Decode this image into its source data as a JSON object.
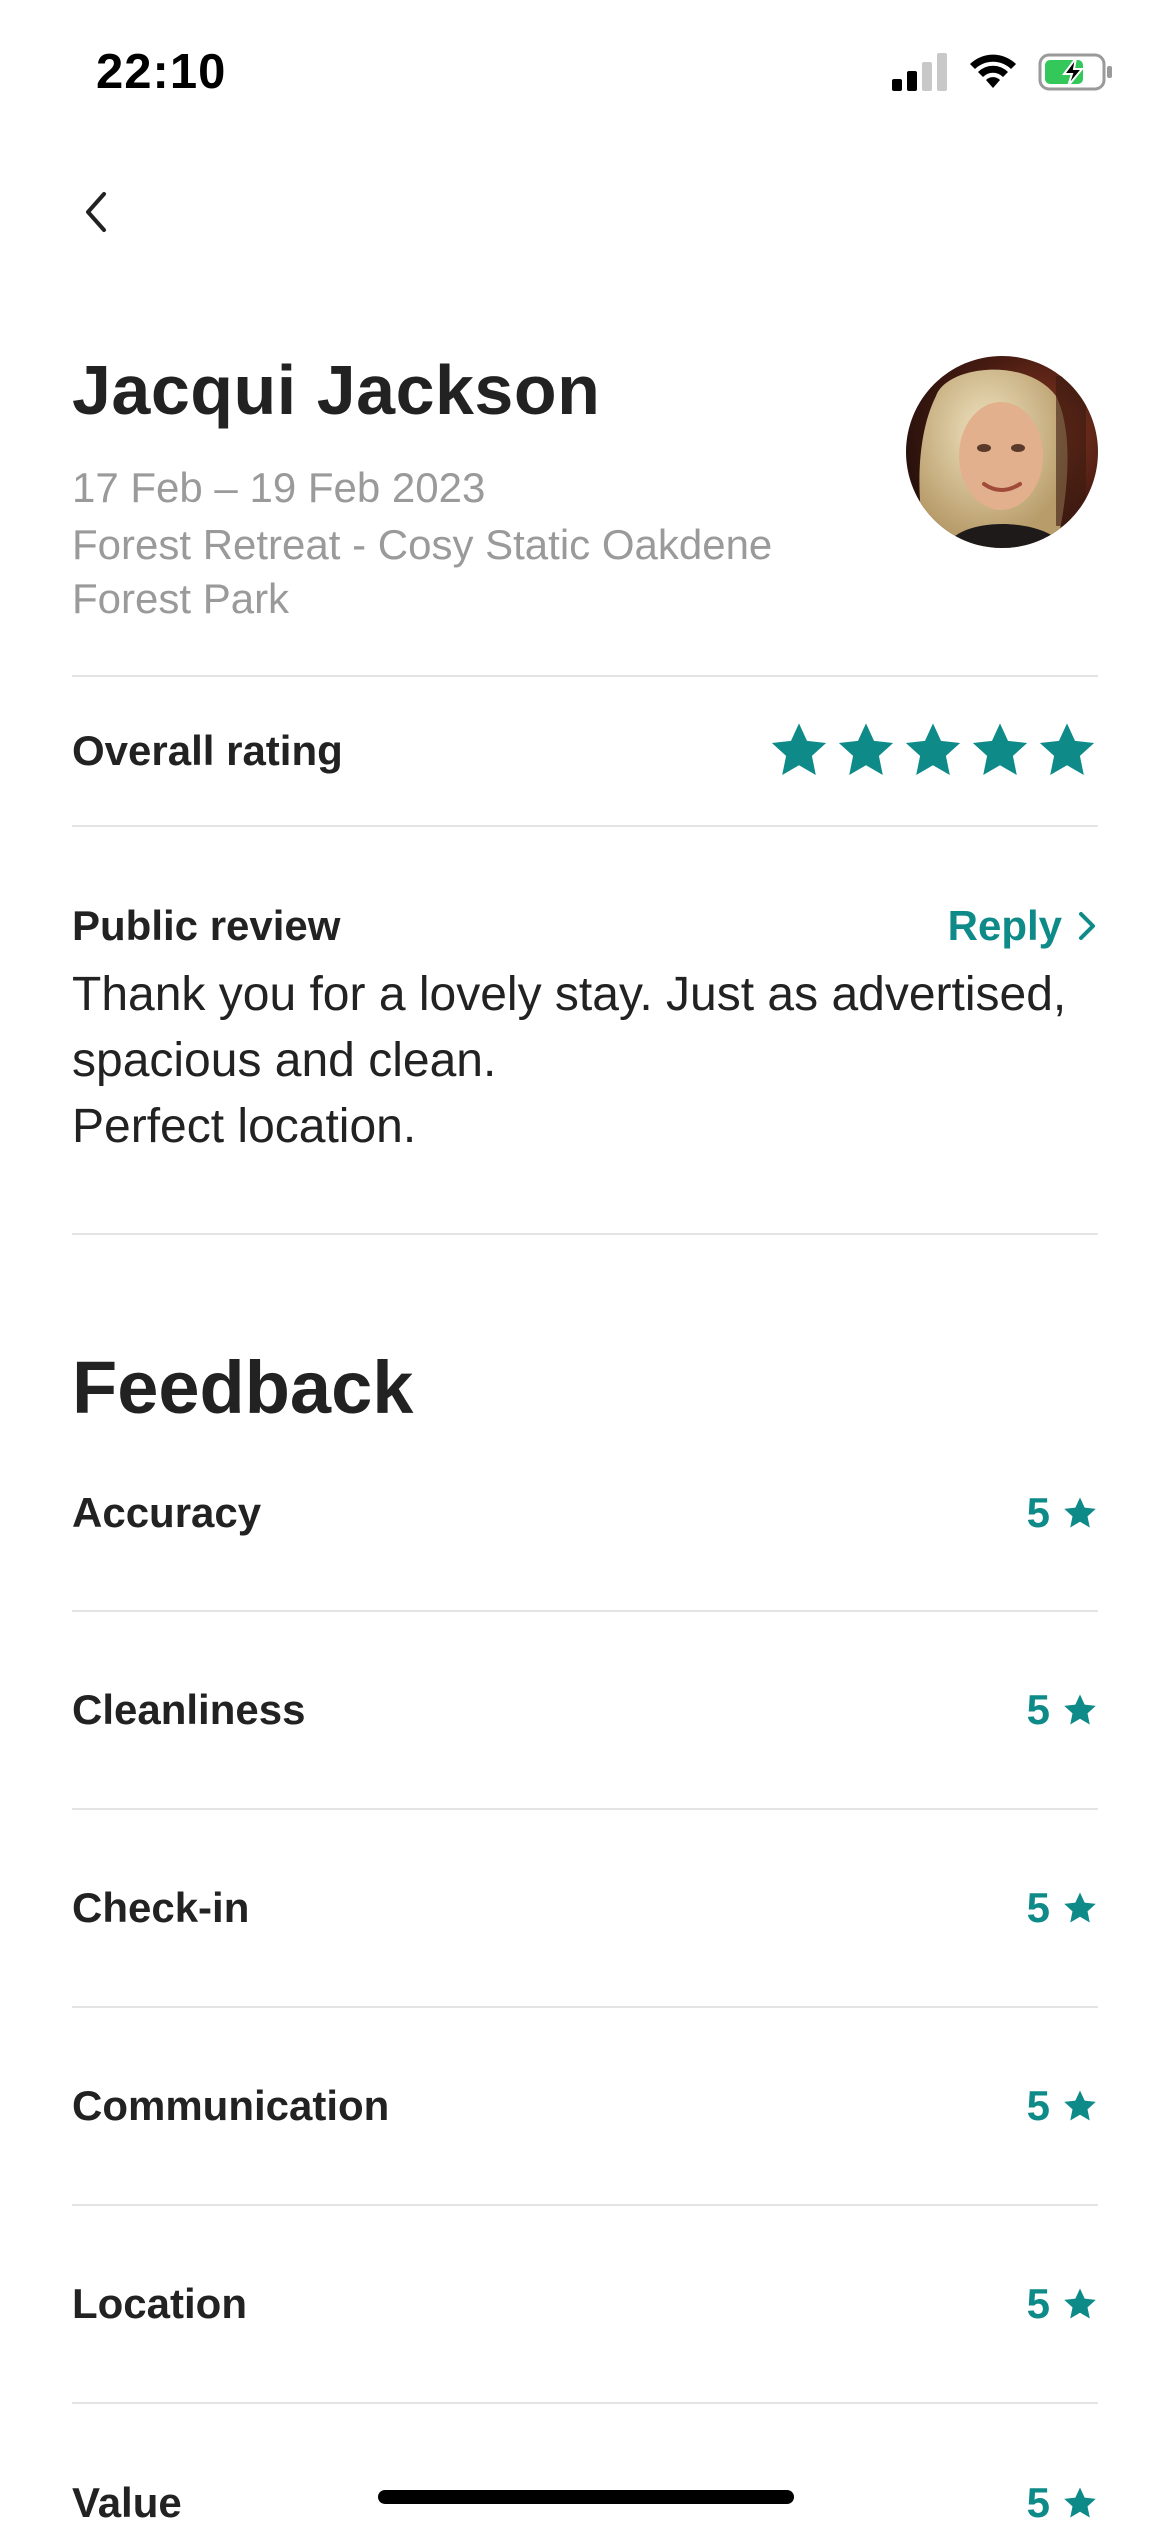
{
  "status_bar": {
    "time": "22:10"
  },
  "guest": {
    "name": "Jacqui Jackson",
    "dates": "17 Feb – 19 Feb 2023",
    "listing_line1": "Forest Retreat - Cosy Static Oakdene",
    "listing_line2": "Forest Park"
  },
  "overall": {
    "label": "Overall rating",
    "stars": 5
  },
  "review": {
    "label": "Public review",
    "reply_label": "Reply",
    "line1": "Thank you for a lovely stay. Just as advertised,",
    "line2": "spacious and clean.",
    "line3": "Perfect location."
  },
  "feedback": {
    "title": "Feedback",
    "items": [
      {
        "label": "Accuracy",
        "score": "5"
      },
      {
        "label": "Cleanliness",
        "score": "5"
      },
      {
        "label": "Check-in",
        "score": "5"
      },
      {
        "label": "Communication",
        "score": "5"
      },
      {
        "label": "Location",
        "score": "5"
      },
      {
        "label": "Value",
        "score": "5"
      }
    ]
  },
  "colors": {
    "accent": "#0e8a88",
    "text": "#222222",
    "muted": "#9a9a9a",
    "divider": "#e4e4e4"
  }
}
